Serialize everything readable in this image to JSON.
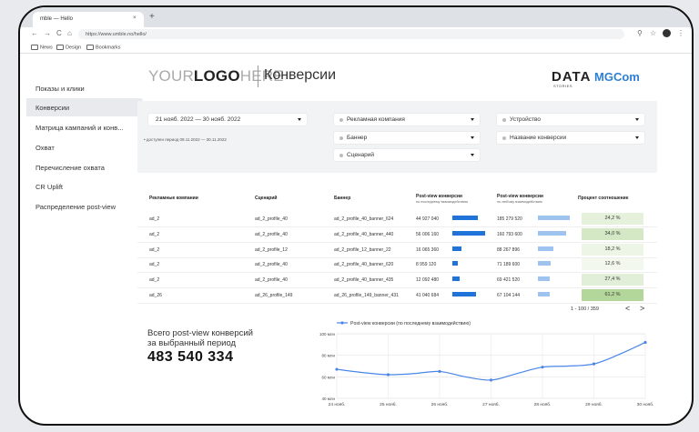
{
  "browser": {
    "tab_title": "mble — Hello",
    "tab_close": "×",
    "new_tab": "+",
    "nav_back": "←",
    "nav_forward": "→",
    "nav_reload": "C",
    "home": "⌂",
    "url": "https://www.umble.no/hello/",
    "zoom_icon": "⚲",
    "star_icon": "☆",
    "menu_icon": "⋮",
    "bookmarks": [
      "News",
      "Design",
      "Bookmarks"
    ]
  },
  "sidebar": {
    "items": [
      {
        "label": "Показы и клики",
        "active": false
      },
      {
        "label": "Конверсии",
        "active": true
      },
      {
        "label": "Матрица кампаний и конв...",
        "active": false
      },
      {
        "label": "Охват",
        "active": false
      },
      {
        "label": "Перечисление охвата",
        "active": false
      },
      {
        "label": "CR Uplift",
        "active": false
      },
      {
        "label": "Распределение post-view",
        "active": false
      }
    ]
  },
  "header": {
    "logo_your": "YOUR",
    "logo_logo": "LOGO",
    "logo_here": "HERE",
    "title": "Конверсии",
    "brand1": "DATA",
    "brand1_sub": "STORIES",
    "brand2": "MGCom"
  },
  "filters": {
    "date_range": "21 нояб. 2022 — 30 нояб. 2022",
    "available_period": "• доступен период 09.11.2022 — 30.11.2022",
    "campaign": "Рекламная компания",
    "banner": "Баннер",
    "scenario": "Сценарий",
    "device": "Устройство",
    "conversion_name": "Название конверсии"
  },
  "table": {
    "headers": {
      "campaign": "Рекламные компании",
      "scenario": "Сценарий",
      "banner": "Баннер",
      "pv_last": "Post-view конверсии",
      "pv_last_sub": "по последнему взаимодействию",
      "pv_any": "Post-view конверсии",
      "pv_any_sub": "по любому взаимодействию",
      "ratio": "Процент соотношение"
    },
    "rows": [
      {
        "campaign": "ad_2",
        "scenario": "ad_2_profile_40",
        "banner": "ad_2_profile_40_banner_624",
        "pv_last": "44 927 040",
        "pv_last_frac": 0.79,
        "pv_any": "185 279 520",
        "pv_any_frac": 0.98,
        "ratio": "24,2 %",
        "ratio_color": "#e6f1dc"
      },
      {
        "campaign": "ad_2",
        "scenario": "ad_2_profile_40",
        "banner": "ad_2_profile_40_banner_440",
        "pv_last": "56 006 160",
        "pv_last_frac": 1.0,
        "pv_any": "160 793 600",
        "pv_any_frac": 0.85,
        "ratio": "34,0 %",
        "ratio_color": "#d5e8c5"
      },
      {
        "campaign": "ad_2",
        "scenario": "ad_2_profile_12",
        "banner": "ad_2_profile_12_banner_22",
        "pv_last": "16 065 360",
        "pv_last_frac": 0.29,
        "pv_any": "88 267 896",
        "pv_any_frac": 0.47,
        "ratio": "18,2 %",
        "ratio_color": "#edf5e6"
      },
      {
        "campaign": "ad_2",
        "scenario": "ad_2_profile_40",
        "banner": "ad_2_profile_40_banner_620",
        "pv_last": "8 959 120",
        "pv_last_frac": 0.16,
        "pv_any": "71 189 600",
        "pv_any_frac": 0.38,
        "ratio": "12,6 %",
        "ratio_color": "#f3f8ee"
      },
      {
        "campaign": "ad_2",
        "scenario": "ad_2_profile_40",
        "banner": "ad_2_profile_40_banner_435",
        "pv_last": "12 092 480",
        "pv_last_frac": 0.22,
        "pv_any": "69 421 520",
        "pv_any_frac": 0.37,
        "ratio": "27,4 %",
        "ratio_color": "#e2efd8"
      },
      {
        "campaign": "ad_26",
        "scenario": "ad_26_profile_149",
        "banner": "ad_26_profile_149_banner_431",
        "pv_last": "41 040 684",
        "pv_last_frac": 0.73,
        "pv_any": "67 104 144",
        "pv_any_frac": 0.36,
        "ratio": "61,2 %",
        "ratio_color": "#b3d69a"
      }
    ],
    "pagination": "1 - 100 / 359",
    "prev": "<",
    "next": ">"
  },
  "summary": {
    "label_line1": "Всего post-view конверсий",
    "label_line2": "за выбранный период",
    "value": "483 540 334"
  },
  "colors": {
    "accent": "#2f7fd6",
    "bar_last": "#1f73d9",
    "bar_any": "#9ec3ef",
    "line": "#4a86e8"
  },
  "chart_data": {
    "type": "line",
    "legend": "Post-view конверсии (по последнему взаимодействию)",
    "x": [
      "24 нояб.",
      "25 нояб.",
      "26 нояб.",
      "27 нояб.",
      "28 нояб.",
      "29 нояб.",
      "30 нояб."
    ],
    "series": [
      {
        "name": "Post-view конверсии (по последнему взаимодействию)",
        "values": [
          67,
          62,
          65,
          57,
          69,
          72,
          92
        ]
      }
    ],
    "x_full": [
      24,
      24.5,
      25,
      25.5,
      26,
      26.5,
      27,
      27.5,
      28,
      28.5,
      29,
      29.5,
      30
    ],
    "y_values": [
      67,
      64,
      62,
      63,
      65,
      60,
      57,
      63,
      69,
      70,
      72,
      81,
      92
    ],
    "y_ticks": [
      "40 млн",
      "60 млн",
      "80 млн",
      "100 млн"
    ],
    "ylim": [
      40,
      100
    ],
    "legend_position": "top"
  }
}
